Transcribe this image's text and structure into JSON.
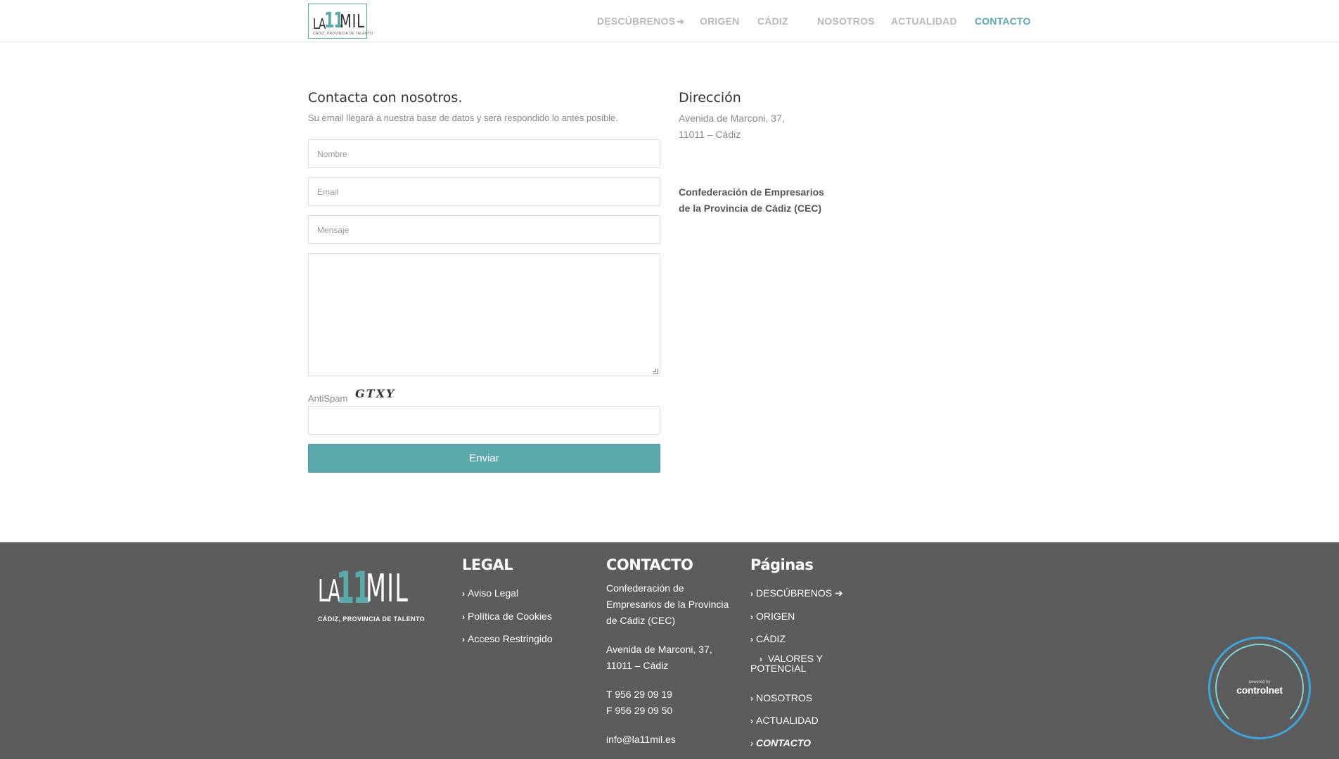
{
  "header": {
    "logo": {
      "la": "LA",
      "eleven": "11",
      "mil": "MIL",
      "tagline": "CÁDIZ, PROVINCIA DE TALENTO"
    },
    "nav": [
      {
        "label": "DESCÚBRENOS",
        "icon": "arrow-right-icon"
      },
      {
        "label": "ORIGEN"
      },
      {
        "label": "CÁDIZ"
      },
      {
        "label": "NOSOTROS"
      },
      {
        "label": "ACTUALIDAD"
      },
      {
        "label": "CONTACTO",
        "active": true
      }
    ]
  },
  "contact_form": {
    "title": "Contacta con nosotros.",
    "intro": "Su email llegará a nuestra base de datos y será respondido lo antes posible.",
    "name_placeholder": "Nombre",
    "email_placeholder": "Email",
    "subject_placeholder": "Mensaje",
    "message_value": "",
    "antispam_label": "AntiSpam",
    "captcha_text": "GTXY",
    "antispam_value": "",
    "submit_label": "Enviar"
  },
  "address": {
    "title": "Dirección",
    "line1": "Avenida de Marconi, 37,",
    "line2": "11011 – Cádiz",
    "org_line1": "Confederación de Empresarios",
    "org_line2": "de la Provincia de Cádiz (CEC)"
  },
  "footer": {
    "logo": {
      "la": "LA",
      "eleven": "11",
      "mil": "MIL",
      "tagline": "CÁDIZ, PROVINCIA DE TALENTO"
    },
    "legal": {
      "heading": "LEGAL",
      "links": [
        "Aviso Legal",
        "Política de Cookies",
        "Acceso Restringido"
      ]
    },
    "contacto": {
      "heading": "CONTACTO",
      "org_lines": [
        "Confederación de",
        "Empresarios de la Provincia",
        "de Cádiz (CEC)"
      ],
      "address_lines": [
        "Avenida de Marconi, 37,",
        "11011 – Cádiz"
      ],
      "phone": "T 956 29 09 19",
      "fax": "F 956 29 09 50",
      "email": "info@la11mil.es"
    },
    "paginas": {
      "heading": "Páginas",
      "links": [
        "DESCÚBRENOS",
        "ORIGEN",
        "CÁDIZ",
        "VALORES Y",
        "POTENCIAL",
        "NOSOTROS",
        "ACTUALIDAD",
        "CONTACTO"
      ]
    }
  },
  "badge": {
    "small": "powered by",
    "brand": "controlnet"
  },
  "colors": {
    "accent": "#5aa9ad",
    "footer_bg": "#5c5c5c",
    "nav_inactive": "#b8b8b8",
    "badge_ring": "#3aa7e0"
  }
}
